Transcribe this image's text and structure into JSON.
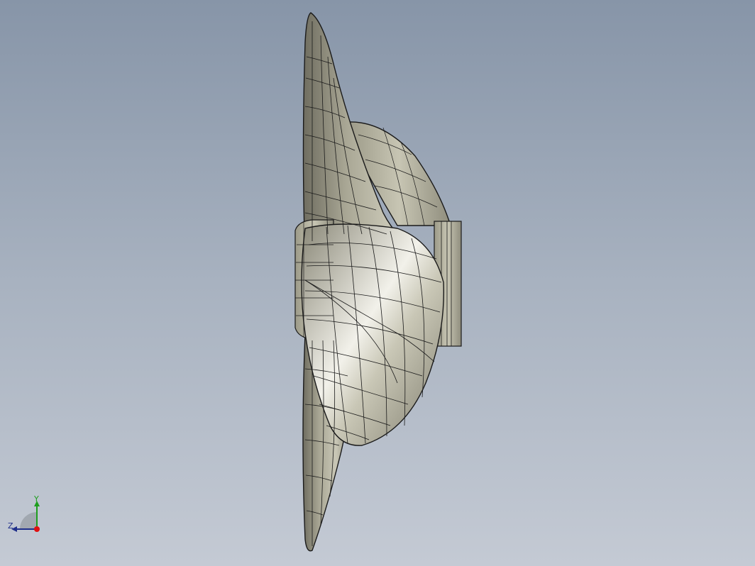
{
  "viewport": {
    "background_top": "#8795a8",
    "background_bottom": "#c4cad4"
  },
  "model": {
    "description_icon": "propeller-model",
    "surface_color": "#b9b6a3",
    "edge_color": "#1a1a1a"
  },
  "triad": {
    "y_label": "Y",
    "z_label": "Z",
    "y_color": "#1e9e1e",
    "z_color": "#1f2f8a",
    "x_color": "#e01010"
  }
}
